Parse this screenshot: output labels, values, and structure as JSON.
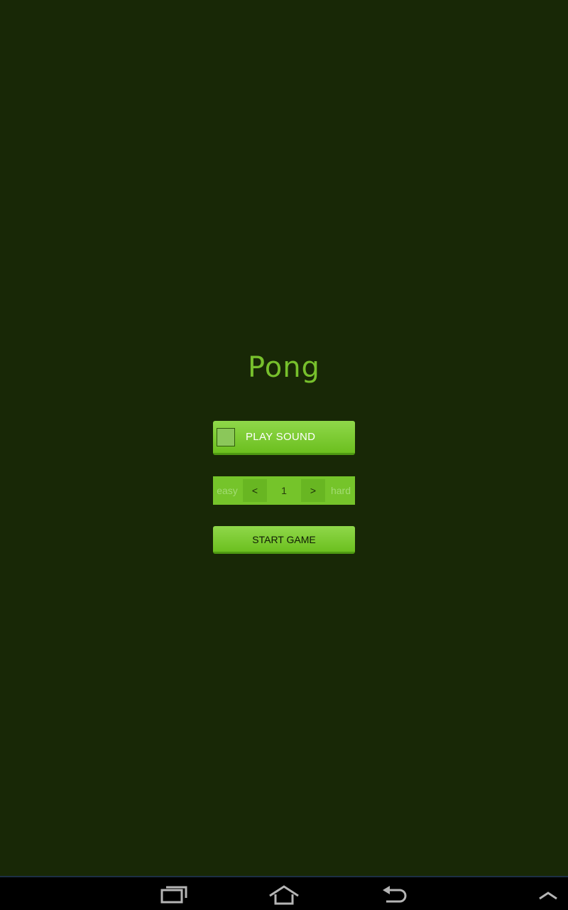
{
  "app": {
    "title": "Pong"
  },
  "controls": {
    "sound_label": "PLAY SOUND",
    "sound_checked": false,
    "difficulty": {
      "min_label": "easy",
      "decrement_label": "<",
      "value": "1",
      "increment_label": ">",
      "max_label": "hard"
    },
    "start_label": "START GAME"
  },
  "navigation": {
    "icons": [
      "recent-apps-icon",
      "home-icon",
      "back-icon",
      "menu-up-icon"
    ]
  },
  "colors": {
    "background": "#182806",
    "accent": "#77c02c",
    "button": "#75c42a"
  }
}
